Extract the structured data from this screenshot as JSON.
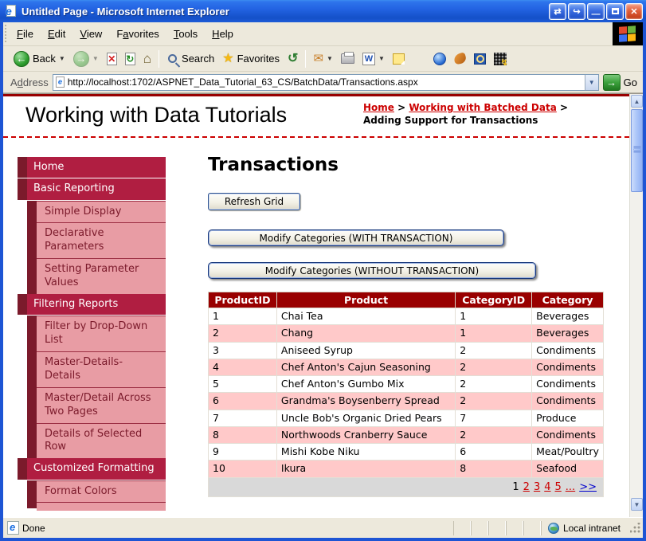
{
  "window": {
    "title": "Untitled Page - Microsoft Internet Explorer"
  },
  "menu_bar": {
    "items": [
      {
        "label": "File",
        "accel_index": 0
      },
      {
        "label": "Edit",
        "accel_index": 0
      },
      {
        "label": "View",
        "accel_index": 0
      },
      {
        "label": "Favorites",
        "accel_index": 1
      },
      {
        "label": "Tools",
        "accel_index": 0
      },
      {
        "label": "Help",
        "accel_index": 0
      }
    ]
  },
  "toolbar": {
    "back_label": "Back",
    "search_label": "Search",
    "favorites_label": "Favorites"
  },
  "address_bar": {
    "label_pre": "A",
    "label_accel": "d",
    "label_post": "dress",
    "url": "http://localhost:1702/ASPNET_Data_Tutorial_63_CS/BatchData/Transactions.aspx",
    "go_label": "Go"
  },
  "page": {
    "site_title": "Working with Data Tutorials",
    "breadcrumb": [
      {
        "label": "Home",
        "type": "link"
      },
      {
        "label": "Working with Batched Data",
        "type": "link"
      },
      {
        "label": "Adding Support for Transactions",
        "type": "current"
      }
    ],
    "sidebar": [
      {
        "label": "Home",
        "level": 1
      },
      {
        "label": "Basic Reporting",
        "level": 1
      },
      {
        "label": "Simple Display",
        "level": 2
      },
      {
        "label": "Declarative Parameters",
        "level": 2
      },
      {
        "label": "Setting Parameter Values",
        "level": 2
      },
      {
        "label": "Filtering Reports",
        "level": 1
      },
      {
        "label": "Filter by Drop-Down List",
        "level": 2
      },
      {
        "label": "Master-Details-Details",
        "level": 2
      },
      {
        "label": "Master/Detail Across Two Pages",
        "level": 2
      },
      {
        "label": "Details of Selected Row",
        "level": 2
      },
      {
        "label": "Customized Formatting",
        "level": 1
      },
      {
        "label": "Format Colors",
        "level": 2
      }
    ],
    "main": {
      "heading": "Transactions",
      "buttons": {
        "refresh": "Refresh Grid",
        "with_transaction": "Modify Categories (WITH TRANSACTION)",
        "without_transaction": "Modify Categories (WITHOUT TRANSACTION)"
      },
      "grid": {
        "columns": [
          "ProductID",
          "Product",
          "CategoryID",
          "Category"
        ],
        "rows": [
          [
            "1",
            "Chai Tea",
            "1",
            "Beverages"
          ],
          [
            "2",
            "Chang",
            "1",
            "Beverages"
          ],
          [
            "3",
            "Aniseed Syrup",
            "2",
            "Condiments"
          ],
          [
            "4",
            "Chef Anton's Cajun Seasoning",
            "2",
            "Condiments"
          ],
          [
            "5",
            "Chef Anton's Gumbo Mix",
            "2",
            "Condiments"
          ],
          [
            "6",
            "Grandma's Boysenberry Spread",
            "2",
            "Condiments"
          ],
          [
            "7",
            "Uncle Bob's Organic Dried Pears",
            "7",
            "Produce"
          ],
          [
            "8",
            "Northwoods Cranberry Sauce",
            "2",
            "Condiments"
          ],
          [
            "9",
            "Mishi Kobe Niku",
            "6",
            "Meat/Poultry"
          ],
          [
            "10",
            "Ikura",
            "8",
            "Seafood"
          ]
        ],
        "pager": {
          "current": "1",
          "pages": [
            "2",
            "3",
            "4",
            "5"
          ],
          "ellipsis": "...",
          "next": ">>"
        }
      }
    }
  },
  "status_bar": {
    "text": "Done",
    "zone": "Local intranet"
  },
  "colors": {
    "window_frame": "#1E55D4",
    "chrome_bg": "#EDE9DC",
    "accent_red": "#B01E41",
    "sidebar_dark": "#7B1A2B",
    "sidebar_pink": "#E89CA4",
    "sidebar_text_dark": "#7B1A2B",
    "grid_header": "#990000",
    "grid_pink": "#FFC9C9",
    "pager_bg": "#D9D9D9",
    "link_red": "#CC0000",
    "link_blue": "#0000CC",
    "go_green": "#3BA13B"
  }
}
